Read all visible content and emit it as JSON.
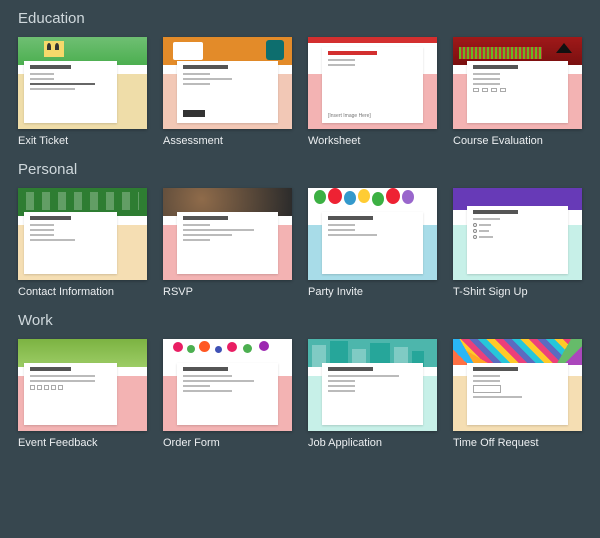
{
  "sections": [
    {
      "title": "Education",
      "items": [
        {
          "label": "Exit Ticket"
        },
        {
          "label": "Assessment"
        },
        {
          "label": "Worksheet"
        },
        {
          "label": "Course Evaluation"
        }
      ]
    },
    {
      "title": "Personal",
      "items": [
        {
          "label": "Contact Information"
        },
        {
          "label": "RSVP"
        },
        {
          "label": "Party Invite"
        },
        {
          "label": "T-Shirt Sign Up"
        }
      ]
    },
    {
      "title": "Work",
      "items": [
        {
          "label": "Event Feedback"
        },
        {
          "label": "Order Form"
        },
        {
          "label": "Job Application"
        },
        {
          "label": "Time Off Request"
        }
      ]
    }
  ]
}
